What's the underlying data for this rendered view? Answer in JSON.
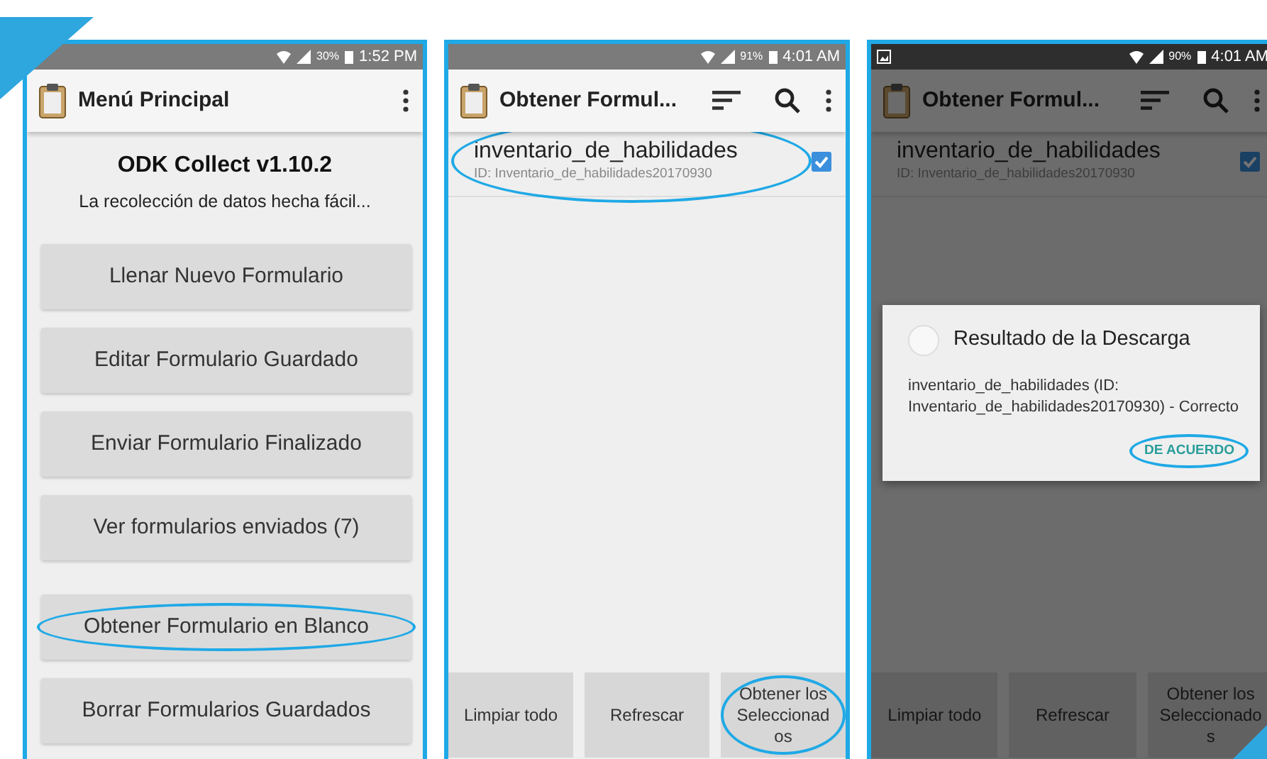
{
  "panels": [
    {
      "kind": "menu",
      "status_bar": {
        "battery": "30%",
        "time": "1:52 PM"
      },
      "toolbar": {
        "title": "Menú Principal"
      },
      "app_title": "ODK Collect v1.10.2",
      "tagline": "La recolección de datos hecha fácil...",
      "button_groups": [
        [
          {
            "label": "Llenar Nuevo Formulario",
            "circled": false
          },
          {
            "label": "Editar Formulario Guardado",
            "circled": false
          },
          {
            "label": "Enviar Formulario Finalizado",
            "circled": false
          },
          {
            "label": "Ver formularios enviados (7)",
            "circled": false
          }
        ],
        [
          {
            "label": "Obtener Formulario en Blanco",
            "circled": true
          },
          {
            "label": "Borrar Formularios Guardados",
            "circled": false
          }
        ]
      ]
    },
    {
      "kind": "list",
      "status_bar": {
        "battery": "91%",
        "time": "4:01 AM"
      },
      "toolbar": {
        "title": "Obtener Formul...",
        "sort_button": true,
        "search_button": true
      },
      "forms": [
        {
          "name": "inventario_de_habilidades",
          "id": "ID: Inventario_de_habilidades20170930",
          "checked": true,
          "circled": true
        }
      ],
      "bottom_buttons": [
        {
          "label": "Limpiar todo",
          "circled": false
        },
        {
          "label": "Refrescar",
          "circled": false
        },
        {
          "label": "Obtener los Seleccionados",
          "circled": true
        }
      ]
    },
    {
      "kind": "list",
      "dimmed": true,
      "status_bar": {
        "battery": "90%",
        "time": "4:01 AM",
        "notification": true
      },
      "toolbar": {
        "title": "Obtener Formul...",
        "sort_button": true,
        "search_button": true
      },
      "forms": [
        {
          "name": "inventario_de_habilidades",
          "id": "ID: Inventario_de_habilidades20170930",
          "checked": true,
          "circled": false
        }
      ],
      "bottom_buttons": [
        {
          "label": "Limpiar todo",
          "circled": false
        },
        {
          "label": "Refrescar",
          "circled": false
        },
        {
          "label": "Obtener los Seleccionados",
          "circled": false
        }
      ],
      "dialog": {
        "title": "Resultado de la Descarga",
        "message": "inventario_de_habilidades (ID: Inventario_de_habilidades20170930) - Correcto",
        "action": {
          "label": "DE ACUERDO",
          "circled": true
        }
      }
    }
  ]
}
